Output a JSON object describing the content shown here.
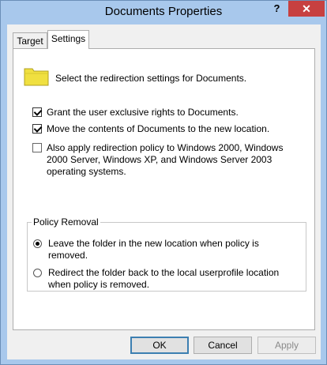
{
  "window": {
    "title": "Documents Properties",
    "help_label": "?",
    "close_label": "✕"
  },
  "tabs": [
    {
      "label": "Target",
      "selected": false
    },
    {
      "label": "Settings",
      "selected": true
    }
  ],
  "settings": {
    "heading": "Select the redirection settings for Documents.",
    "options": [
      {
        "label": "Grant the user exclusive rights to Documents.",
        "checked": true
      },
      {
        "label": "Move the contents of Documents to the new location.",
        "checked": true
      },
      {
        "label": "Also apply redirection policy to Windows 2000, Windows 2000 Server, Windows XP, and Windows Server 2003 operating systems.",
        "checked": false
      }
    ]
  },
  "policy_removal": {
    "legend": "Policy Removal",
    "options": [
      {
        "label": "Leave the folder in the new location when policy is removed.",
        "selected": true
      },
      {
        "label": "Redirect the folder back to the local userprofile location when policy is removed.",
        "selected": false
      }
    ]
  },
  "buttons": {
    "ok": "OK",
    "cancel": "Cancel",
    "apply": "Apply"
  },
  "colors": {
    "title_bar": "#a8c8ec",
    "close_button": "#c74040",
    "folder": "#f0e040"
  },
  "icons": {
    "folder": "folder-icon"
  }
}
